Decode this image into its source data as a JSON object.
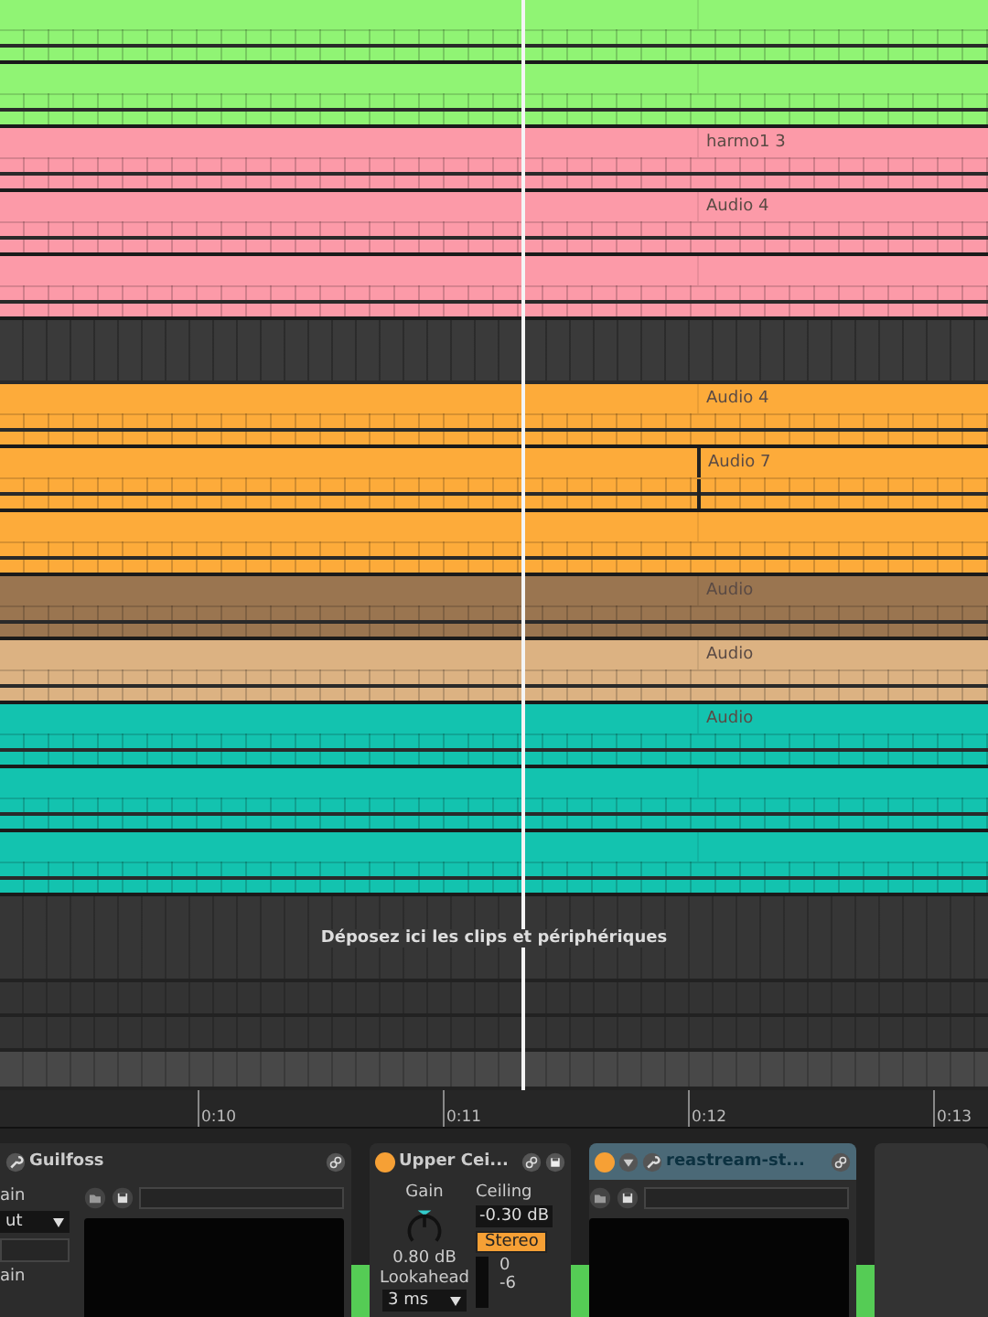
{
  "lanes": [
    {
      "kind": "clip",
      "color": "#90f474",
      "split": false
    },
    {
      "kind": "clip",
      "color": "#90f474",
      "split": false
    },
    {
      "kind": "clip",
      "color": "#fc9aa8",
      "label": "harmo1 3",
      "split": false
    },
    {
      "kind": "clip",
      "color": "#fc9aa8",
      "label": "Audio 4",
      "split": false
    },
    {
      "kind": "clip",
      "color": "#fc9aa8",
      "split": false
    },
    {
      "kind": "empty"
    },
    {
      "kind": "clip",
      "color": "#fdab3a",
      "label": "Audio 4",
      "split": false
    },
    {
      "kind": "clip",
      "color": "#fdab3a",
      "label": "Audio 7",
      "split": true
    },
    {
      "kind": "clip",
      "color": "#fdab3a",
      "split": false
    },
    {
      "kind": "clip",
      "color": "#9a7550",
      "label": "Audio",
      "split": false
    },
    {
      "kind": "clip",
      "color": "#dcb282",
      "label": "Audio",
      "split": false
    },
    {
      "kind": "clip",
      "color": "#13c3af",
      "label": "Audio",
      "split": false
    },
    {
      "kind": "clip",
      "color": "#13c3af",
      "split": false
    },
    {
      "kind": "clip",
      "color": "#13c3af",
      "split": false
    }
  ],
  "drop_zone": "Déposez ici les clips et périphériques",
  "ruler": [
    "0:10",
    "0:11",
    "0:12",
    "0:13"
  ],
  "devices": [
    {
      "kind": "plugin",
      "title": "Guilfoss",
      "highlighted": false,
      "side": {
        "label_top": "ain",
        "dropdown": "ut",
        "label_bottom": "ain"
      }
    },
    {
      "kind": "limiter",
      "title": "Upper Cei...",
      "power": true,
      "gain_label": "Gain",
      "gain_value": "0.80 dB",
      "lookahead_label": "Lookahead",
      "lookahead_value": "3 ms",
      "ceiling_label": "Ceiling",
      "ceiling_value": "-0.30 dB",
      "stereo": "Stereo",
      "meter_ticks": [
        "0",
        "-6"
      ]
    },
    {
      "kind": "plugin",
      "title": "reastream-st...",
      "power": true,
      "highlighted": true
    },
    {
      "kind": "empty"
    }
  ]
}
